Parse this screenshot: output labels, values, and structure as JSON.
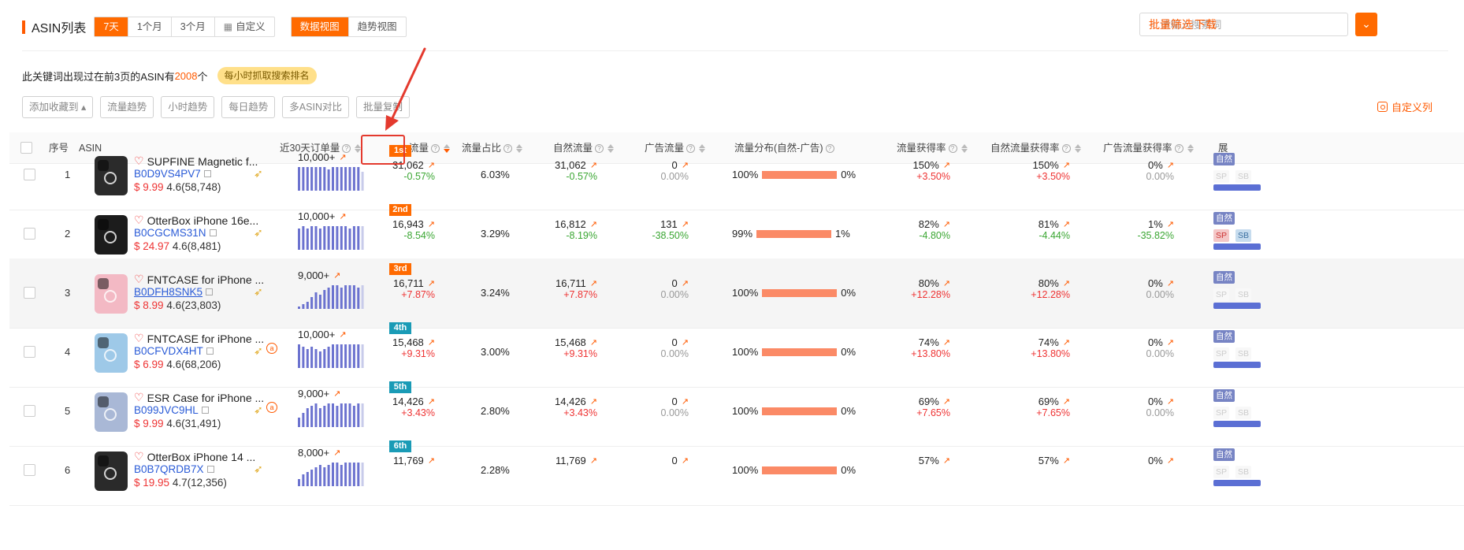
{
  "header": {
    "title": "ASIN列表",
    "time_tabs": [
      "7天",
      "1个月",
      "3个月",
      "自定义"
    ],
    "time_tab_active": "7天",
    "view_tabs": [
      "数据视图",
      "趋势视图"
    ],
    "view_tab_active": "数据视图",
    "search_placeholder": "请输入搜索词",
    "batch_filter": "批量筛选",
    "download": "下载"
  },
  "summary": {
    "prefix": "此关键词出现过在前3页的ASIN有",
    "count": "2008",
    "suffix": "个",
    "badge": "每小时抓取搜索排名"
  },
  "toolbar": {
    "buttons": [
      "添加收藏到 ▴",
      "流量趋势",
      "小时趋势",
      "每日趋势",
      "多ASIN对比",
      "批量复制"
    ],
    "custom_columns": "自定义列"
  },
  "columns": {
    "index": "序号",
    "asin": "ASIN",
    "orders": "近30天订单量",
    "traffic": "流量",
    "share": "流量占比",
    "natural": "自然流量",
    "ad": "广告流量",
    "dist": "流量分布(自然-广告)",
    "rate": "流量获得率",
    "natural_rate": "自然流量获得率",
    "ad_rate": "广告流量获得率",
    "exposure": "展"
  },
  "tag_labels": {
    "natural": "自然",
    "sp": "SP",
    "sb": "SB"
  },
  "colors": {
    "accent": "#ff6a00",
    "rank_top3": "#ff6a00",
    "rank_other": "#1a9bb6",
    "spark": "#6b72cf",
    "dist_bar": "#fb8a66"
  },
  "rows": [
    {
      "index": "1",
      "name": "SUPFINE Magnetic f...",
      "asin": "B0D9VS4PV7",
      "price": "$ 9.99",
      "rating": "4.6(58,748)",
      "amazon_badge": false,
      "orders": "10,000+",
      "rank": "1st",
      "traffic": "31,062",
      "traffic_delta": "-0.57%",
      "share": "6.03%",
      "natural": "31,062",
      "natural_delta": "-0.57%",
      "ad": "0",
      "ad_delta": "0.00%",
      "dist_left": "100%",
      "dist_right": "0%",
      "rate": "150%",
      "rate_delta": "+3.50%",
      "nrate": "150%",
      "nrate_delta": "+3.50%",
      "arate": "0%",
      "arate_delta": "0.00%",
      "sp": false,
      "sb": false,
      "spark": [
        10,
        10,
        10,
        10,
        10,
        10,
        10,
        9,
        10,
        10,
        10,
        10,
        10,
        10,
        10,
        8
      ],
      "thumb": "#2b2b2b"
    },
    {
      "index": "2",
      "name": "OtterBox iPhone 16e...",
      "asin": "B0CGCMS31N",
      "price": "$ 24.97",
      "rating": "4.6(8,481)",
      "amazon_badge": false,
      "orders": "10,000+",
      "rank": "2nd",
      "traffic": "16,943",
      "traffic_delta": "-8.54%",
      "share": "3.29%",
      "natural": "16,812",
      "natural_delta": "-8.19%",
      "ad": "131",
      "ad_delta": "-38.50%",
      "dist_left": "99%",
      "dist_right": "1%",
      "rate": "82%",
      "rate_delta": "-4.80%",
      "nrate": "81%",
      "nrate_delta": "-4.44%",
      "arate": "1%",
      "arate_delta": "-35.82%",
      "sp": true,
      "sb": true,
      "spark": [
        9,
        10,
        9,
        10,
        10,
        9,
        10,
        10,
        10,
        10,
        10,
        10,
        9,
        10,
        10,
        10
      ],
      "thumb": "#1c1c1c"
    },
    {
      "index": "3",
      "name": "FNTCASE for iPhone ...",
      "asin": "B0DFH8SNK5",
      "price": "$ 8.99",
      "rating": "4.6(23,803)",
      "amazon_badge": false,
      "orders": "9,000+",
      "rank": "3rd",
      "traffic": "16,711",
      "traffic_delta": "+7.87%",
      "share": "3.24%",
      "natural": "16,711",
      "natural_delta": "+7.87%",
      "ad": "0",
      "ad_delta": "0.00%",
      "dist_left": "100%",
      "dist_right": "0%",
      "rate": "80%",
      "rate_delta": "+12.28%",
      "nrate": "80%",
      "nrate_delta": "+12.28%",
      "arate": "0%",
      "arate_delta": "0.00%",
      "sp": false,
      "sb": false,
      "spark": [
        1,
        2,
        3,
        5,
        7,
        6,
        8,
        9,
        10,
        10,
        9,
        10,
        10,
        10,
        9,
        10
      ],
      "thumb": "#f3b9c4"
    },
    {
      "index": "4",
      "name": "FNTCASE for iPhone ...",
      "asin": "B0CFVDX4HT",
      "price": "$ 6.99",
      "rating": "4.6(68,206)",
      "amazon_badge": true,
      "orders": "10,000+",
      "rank": "4th",
      "traffic": "15,468",
      "traffic_delta": "+9.31%",
      "share": "3.00%",
      "natural": "15,468",
      "natural_delta": "+9.31%",
      "ad": "0",
      "ad_delta": "0.00%",
      "dist_left": "100%",
      "dist_right": "0%",
      "rate": "74%",
      "rate_delta": "+13.80%",
      "nrate": "74%",
      "nrate_delta": "+13.80%",
      "arate": "0%",
      "arate_delta": "0.00%",
      "sp": false,
      "sb": false,
      "spark": [
        10,
        9,
        8,
        9,
        8,
        7,
        8,
        9,
        10,
        10,
        10,
        10,
        10,
        10,
        10,
        10
      ],
      "thumb": "#9ec9e8"
    },
    {
      "index": "5",
      "name": "ESR Case for iPhone ...",
      "asin": "B099JVC9HL",
      "price": "$ 9.99",
      "rating": "4.6(31,491)",
      "amazon_badge": true,
      "orders": "9,000+",
      "rank": "5th",
      "traffic": "14,426",
      "traffic_delta": "+3.43%",
      "share": "2.80%",
      "natural": "14,426",
      "natural_delta": "+3.43%",
      "ad": "0",
      "ad_delta": "0.00%",
      "dist_left": "100%",
      "dist_right": "0%",
      "rate": "69%",
      "rate_delta": "+7.65%",
      "nrate": "69%",
      "nrate_delta": "+7.65%",
      "arate": "0%",
      "arate_delta": "0.00%",
      "sp": false,
      "sb": false,
      "spark": [
        4,
        6,
        8,
        9,
        10,
        8,
        9,
        10,
        10,
        9,
        10,
        10,
        10,
        9,
        10,
        10
      ],
      "thumb": "#a9b8d6"
    },
    {
      "index": "6",
      "name": "OtterBox iPhone 14 ...",
      "asin": "B0B7QRDB7X",
      "price": "$ 19.95",
      "rating": "4.7(12,356)",
      "amazon_badge": false,
      "orders": "8,000+",
      "rank": "6th",
      "traffic": "11,769",
      "traffic_delta": "",
      "share": "2.28%",
      "natural": "11,769",
      "natural_delta": "",
      "ad": "0",
      "ad_delta": "",
      "dist_left": "100%",
      "dist_right": "0%",
      "rate": "57%",
      "rate_delta": "",
      "nrate": "57%",
      "nrate_delta": "",
      "arate": "0%",
      "arate_delta": "",
      "sp": false,
      "sb": false,
      "spark": [
        3,
        5,
        6,
        7,
        8,
        9,
        8,
        9,
        10,
        10,
        9,
        10,
        10,
        10,
        10,
        10
      ],
      "thumb": "#2a2a2a"
    }
  ]
}
